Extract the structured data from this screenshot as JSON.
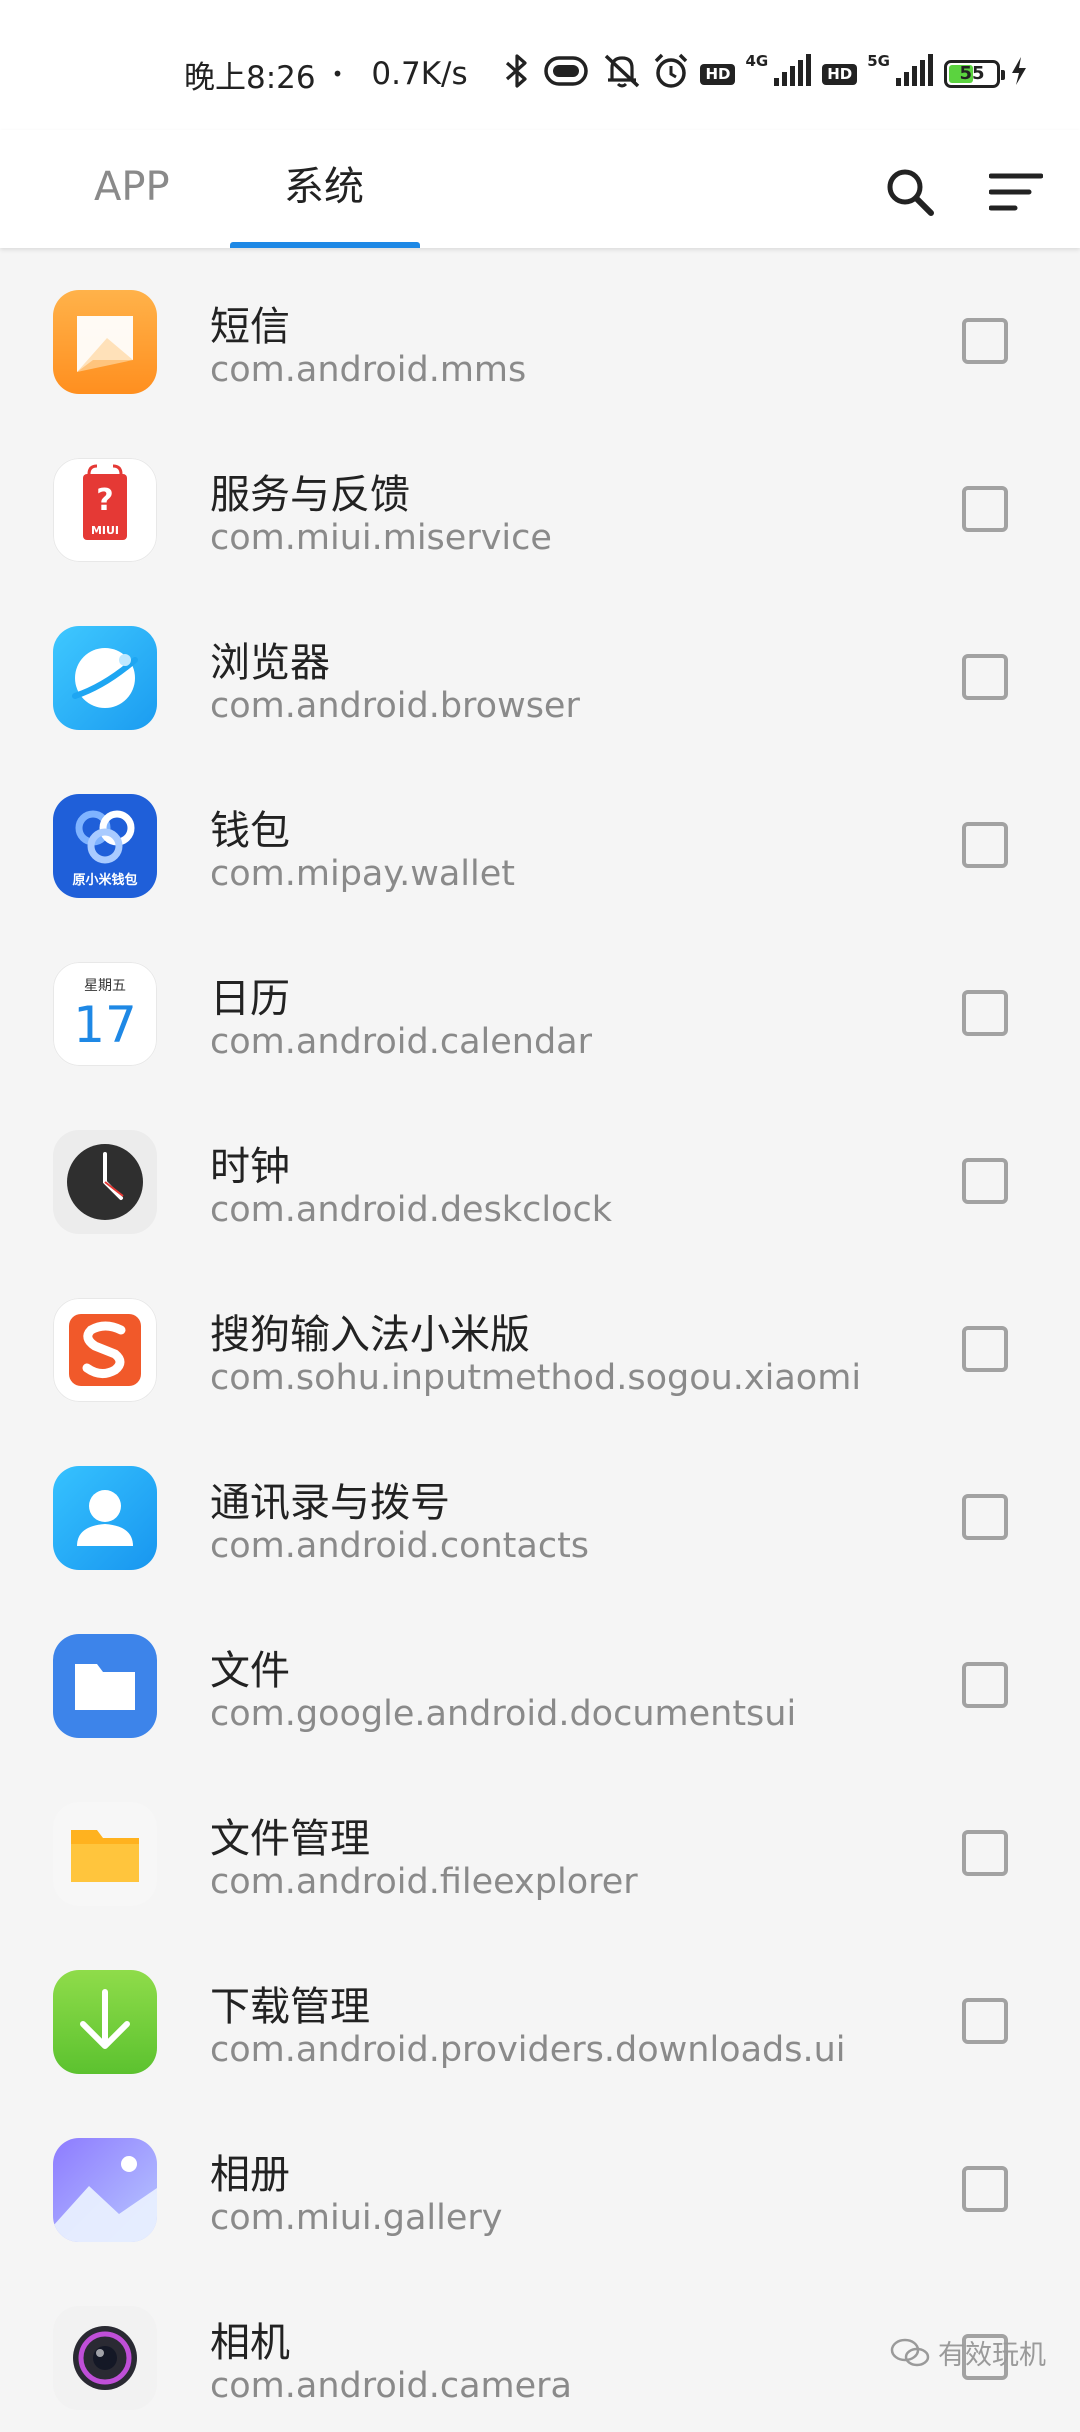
{
  "status_bar": {
    "time": "晚上8:26",
    "dot": "•",
    "speed": "0.7K/s",
    "hd1": "HD",
    "net1": "4G",
    "hd2": "HD",
    "net2": "5G",
    "battery": "55",
    "battery_level": 0.55
  },
  "tabs": [
    {
      "label": "APP",
      "selected": false
    },
    {
      "label": "系统",
      "selected": true
    }
  ],
  "colors": {
    "accent": "#1e88e5",
    "checkbox_border": "#a2a2a2",
    "secondary_text": "#8a8a8a"
  },
  "apps": [
    {
      "name": "短信",
      "package": "com.android.mms",
      "icon": "sms-icon",
      "checked": false
    },
    {
      "name": "服务与反馈",
      "package": "com.miui.miservice",
      "icon": "miui-service-icon",
      "icon_text": "MIUI",
      "checked": false
    },
    {
      "name": "浏览器",
      "package": "com.android.browser",
      "icon": "browser-icon",
      "checked": false
    },
    {
      "name": "钱包",
      "package": "com.mipay.wallet",
      "icon": "wallet-icon",
      "icon_text": "原小米钱包",
      "checked": false
    },
    {
      "name": "日历",
      "package": "com.android.calendar",
      "icon": "calendar-icon",
      "icon_weekday": "星期五",
      "icon_day": "17",
      "checked": false
    },
    {
      "name": "时钟",
      "package": "com.android.deskclock",
      "icon": "clock-icon",
      "checked": false
    },
    {
      "name": "搜狗输入法小米版",
      "package": "com.sohu.inputmethod.sogou.xiaomi",
      "icon": "sogou-icon",
      "checked": false
    },
    {
      "name": "通讯录与拨号",
      "package": "com.android.contacts",
      "icon": "contacts-icon",
      "checked": false
    },
    {
      "name": "文件",
      "package": "com.google.android.documentsui",
      "icon": "files-icon",
      "checked": false
    },
    {
      "name": "文件管理",
      "package": "com.android.fileexplorer",
      "icon": "file-manager-icon",
      "checked": false
    },
    {
      "name": "下载管理",
      "package": "com.android.providers.downloads.ui",
      "icon": "download-manager-icon",
      "checked": false
    },
    {
      "name": "相册",
      "package": "com.miui.gallery",
      "icon": "gallery-icon",
      "checked": false
    },
    {
      "name": "相机",
      "package": "com.android.camera",
      "icon": "camera-icon",
      "checked": false
    }
  ],
  "watermark": "有效玩机"
}
